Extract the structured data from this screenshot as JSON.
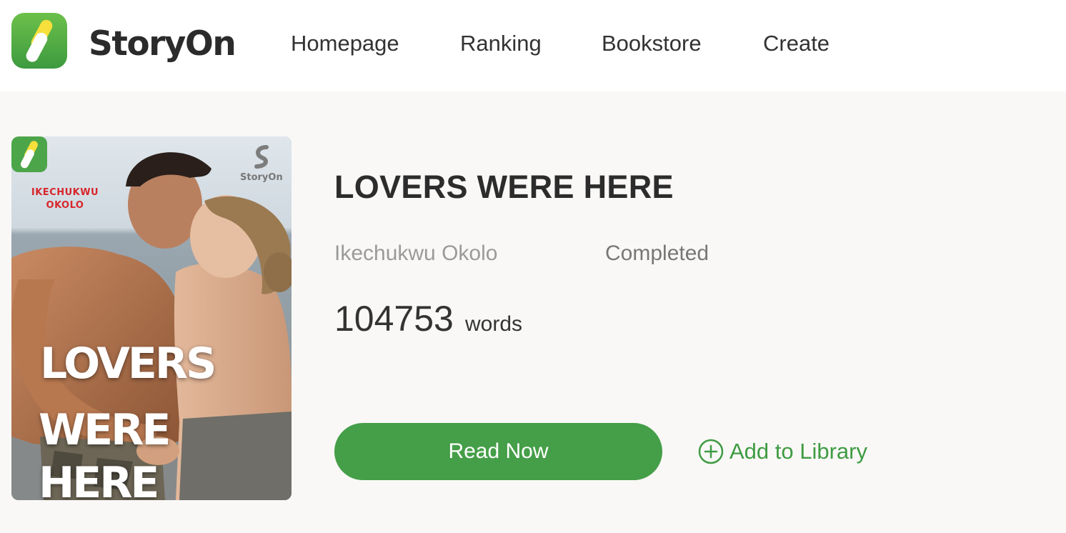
{
  "brand": {
    "name": "StoryOn",
    "accent": "#459e48",
    "logo_icon": "storyon-s-logo-icon"
  },
  "nav": {
    "items": [
      {
        "label": "Homepage"
      },
      {
        "label": "Ranking"
      },
      {
        "label": "Bookstore"
      },
      {
        "label": "Create"
      }
    ]
  },
  "book": {
    "title": "LOVERS WERE HERE",
    "author": "Ikechukwu Okolo",
    "status": "Completed",
    "word_count": "104753",
    "word_unit": "words",
    "cover": {
      "author_text": "IKECHUKWU\nOKOLO",
      "title_line1": "LOVERS",
      "title_line2": "WERE HERE",
      "watermark": "StoryOn",
      "badge_icon": "storyon-s-logo-icon"
    }
  },
  "actions": {
    "read_now": "Read Now",
    "add_to_library": "Add to Library",
    "add_icon": "plus-circle-icon"
  }
}
